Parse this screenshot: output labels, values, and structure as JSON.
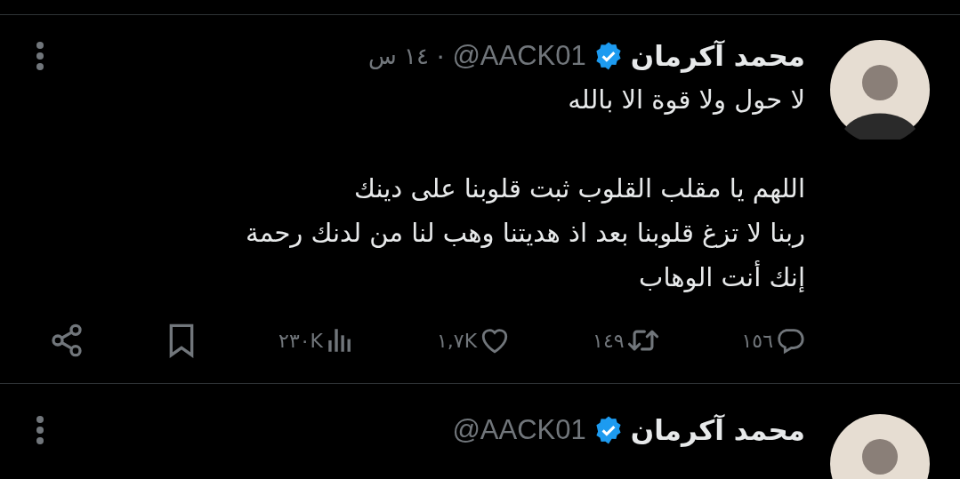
{
  "tweets": [
    {
      "name": "محمد آكرمان",
      "verified": true,
      "handle": "@AACK01",
      "separator": "·",
      "time": "١٤ س",
      "paragraphs": [
        "لا حول ولا قوة الا بالله",
        "اللهم يا مقلب القلوب ثبت قلوبنا على دينك\nربنا لا تزغ قلوبنا بعد اذ هديتنا وهب لنا من لدنك رحمة\nإنك أنت الوهاب"
      ],
      "actions": [
        {
          "kind": "reply",
          "count": "١٥٦"
        },
        {
          "kind": "retweet",
          "count": "١٤٩"
        },
        {
          "kind": "like",
          "count": "١,٧K"
        },
        {
          "kind": "views",
          "count": "٢٣٠K"
        },
        {
          "kind": "bookmark"
        },
        {
          "kind": "share"
        }
      ]
    },
    {
      "name": "محمد آكرمان",
      "verified": true,
      "handle": "@AACK01"
    }
  ]
}
